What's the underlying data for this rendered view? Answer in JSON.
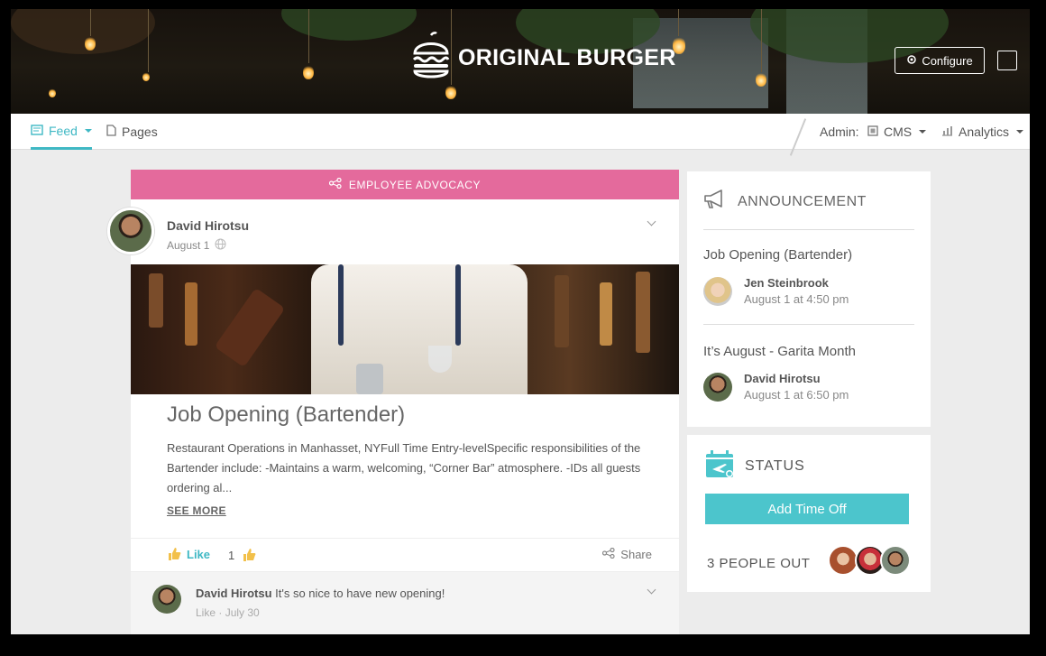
{
  "header": {
    "brand": "ORIGINAL BURGER",
    "configure_label": "Configure"
  },
  "nav": {
    "feed_label": "Feed",
    "pages_label": "Pages",
    "admin_label": "Admin:",
    "cms_label": "CMS",
    "analytics_label": "Analytics"
  },
  "post": {
    "category_label": "EMPLOYEE ADVOCACY",
    "author": "David Hirotsu",
    "date": "August 1",
    "title": "Job Opening (Bartender)",
    "body": "Restaurant Operations in Manhasset, NYFull Time Entry-levelSpecific responsibilities of the Bartender include: -Maintains a warm, welcoming, “Corner Bar” atmosphere. -IDs all guests ordering al...",
    "see_more": "SEE MORE",
    "like_label": "Like",
    "like_count": "1",
    "share_label": "Share"
  },
  "comment": {
    "author": "David Hirotsu",
    "text": "It's so nice to have new opening!",
    "like_label": "Like",
    "separator": "·",
    "date": "July 30"
  },
  "announcement": {
    "heading": "ANNOUNCEMENT",
    "items": [
      {
        "title": "Job Opening (Bartender)",
        "author": "Jen Steinbrook",
        "time": "August 1 at 4:50 pm"
      },
      {
        "title": "It’s August - Garita Month",
        "author": "David Hirotsu",
        "time": "August 1 at 6:50 pm"
      }
    ]
  },
  "status": {
    "heading": "STATUS",
    "button_label": "Add Time Off",
    "people_out": "3 PEOPLE OUT"
  },
  "colors": {
    "accent": "#3fb8c4",
    "advocacy_bar": "#e46a9c",
    "button": "#4cc5cc"
  }
}
